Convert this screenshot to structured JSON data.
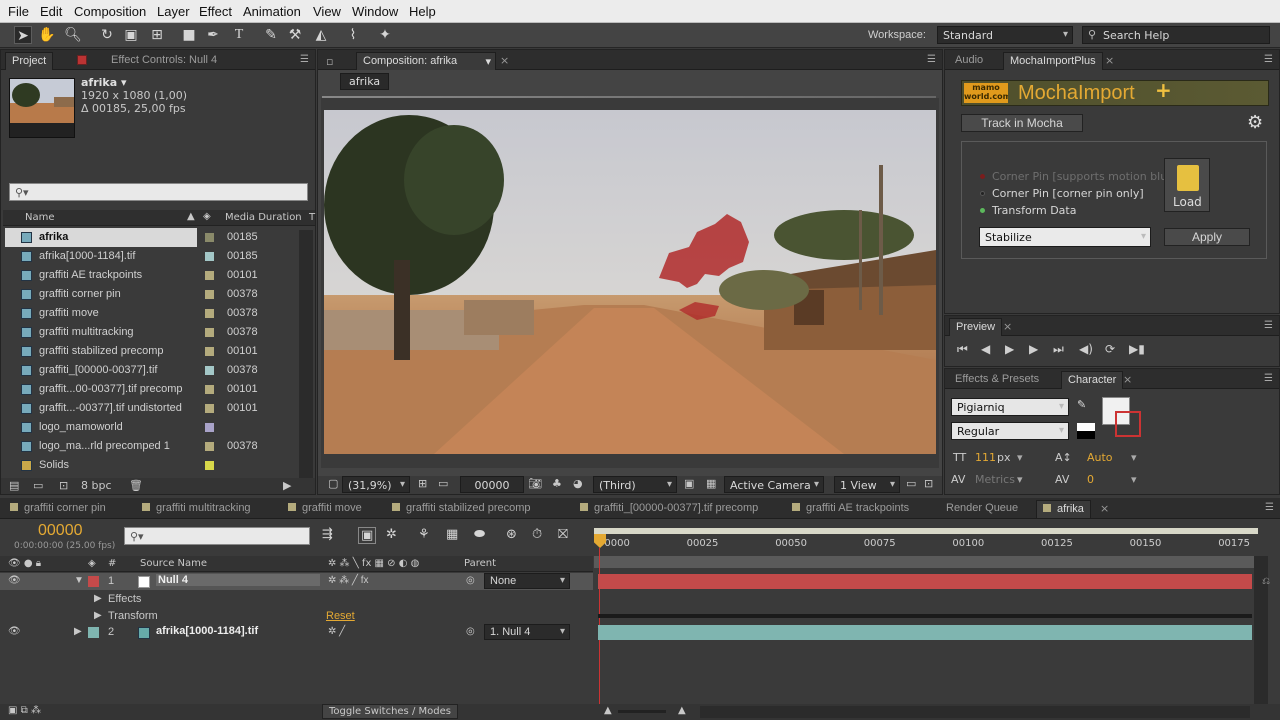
{
  "menu": [
    "File",
    "Edit",
    "Composition",
    "Layer",
    "Effect",
    "Animation",
    "View",
    "Window",
    "Help"
  ],
  "toolbar": {
    "workspace_label": "Workspace:",
    "workspace_value": "Standard",
    "search_placeholder": "Search Help"
  },
  "project_panel": {
    "tab_project": "Project",
    "tab_effect_controls": "Effect Controls: Null 4",
    "item_name": "afrika ▾",
    "item_size": "1920 x 1080 (1,00)",
    "item_duration": "Δ 00185, 25,00 fps",
    "search_placeholder": "",
    "col_name": "Name",
    "col_duration": "Media Duration",
    "col_t": "T",
    "rows": [
      {
        "name": "afrika",
        "duration": "00185",
        "label": "#8a8a6a",
        "selected": true
      },
      {
        "name": "afrika[1000-1184].tif",
        "duration": "00185",
        "label": "#a3c7c7"
      },
      {
        "name": "graffiti AE trackpoints",
        "duration": "00101",
        "label": "#b4ab7d"
      },
      {
        "name": "graffiti corner pin",
        "duration": "00378",
        "label": "#b4ab7d"
      },
      {
        "name": "graffiti move",
        "duration": "00378",
        "label": "#b4ab7d"
      },
      {
        "name": "graffiti multitracking",
        "duration": "00378",
        "label": "#b4ab7d"
      },
      {
        "name": "graffiti stabilized precomp",
        "duration": "00101",
        "label": "#b4ab7d"
      },
      {
        "name": "graffiti_[00000-00377].tif",
        "duration": "00378",
        "label": "#a3c7c7"
      },
      {
        "name": "graffit...00-00377].tif precomp",
        "duration": "00101",
        "label": "#b4ab7d"
      },
      {
        "name": "graffit...-00377].tif undistorted",
        "duration": "00101",
        "label": "#b4ab7d"
      },
      {
        "name": "logo_mamoworld",
        "duration": "",
        "label": "#a9a3c9"
      },
      {
        "name": "logo_ma...rld precomped 1",
        "duration": "00378",
        "label": "#b4ab7d"
      },
      {
        "name": "Solids",
        "duration": "",
        "label": "#d8d84a"
      }
    ],
    "bpc": "8 bpc"
  },
  "composition_panel": {
    "tab": "Composition: afrika",
    "sub_tab": "afrika",
    "zoom": "(31,9%)",
    "timecode": "00000",
    "resolution": "(Third)",
    "camera": "Active Camera",
    "views": "1 View"
  },
  "right_top": {
    "tab_audio": "Audio",
    "tab_mocha": "MochaImportPlus",
    "logo_small": "mamo world.com",
    "logo_title": "MochaImport",
    "logo_plus": "+",
    "track_button": "Track in Mocha",
    "opt1": "Corner Pin [supports motion blur]",
    "opt2": "Corner Pin [corner pin only]",
    "opt3": "Transform Data",
    "load_label": "Load",
    "select_value": "Stabilize",
    "apply_button": "Apply",
    "colors": {
      "opt1": "#7a1d1d",
      "opt2": "#3a3a3a",
      "opt3": "#5cb85c"
    }
  },
  "preview": {
    "tab": "Preview"
  },
  "character": {
    "tab_effects": "Effects & Presets",
    "tab_character": "Character",
    "font": "Pigiarniq",
    "style": "Regular",
    "size": "111",
    "size_unit": "px",
    "leading": "Auto",
    "kerning": "Metrics",
    "tracking": "0"
  },
  "timeline": {
    "tabs": [
      "graffiti corner pin",
      "graffiti multitracking",
      "graffiti move",
      "graffiti stabilized precomp",
      "graffiti_[00000-00377].tif precomp",
      "graffiti AE trackpoints",
      "Render Queue",
      "afrika"
    ],
    "timecode": "00000",
    "timecode_sub": "0:00:00:00 (25.00 fps)",
    "col_hash": "#",
    "col_source": "Source Name",
    "col_parent": "Parent",
    "ruler": [
      "00000",
      "00025",
      "00050",
      "00075",
      "00100",
      "00125",
      "00150",
      "00175"
    ],
    "layers": [
      {
        "num": "1",
        "name": "Null 4",
        "parent": "None",
        "color": "#c44a4a"
      },
      {
        "num": "2",
        "name": "afrika[1000-1184].tif",
        "parent": "1. Null 4",
        "color": "#7fb5b0"
      }
    ],
    "effects_label": "Effects",
    "transform_label": "Transform",
    "reset_label": "Reset",
    "toggle_label": "Toggle Switches / Modes"
  }
}
